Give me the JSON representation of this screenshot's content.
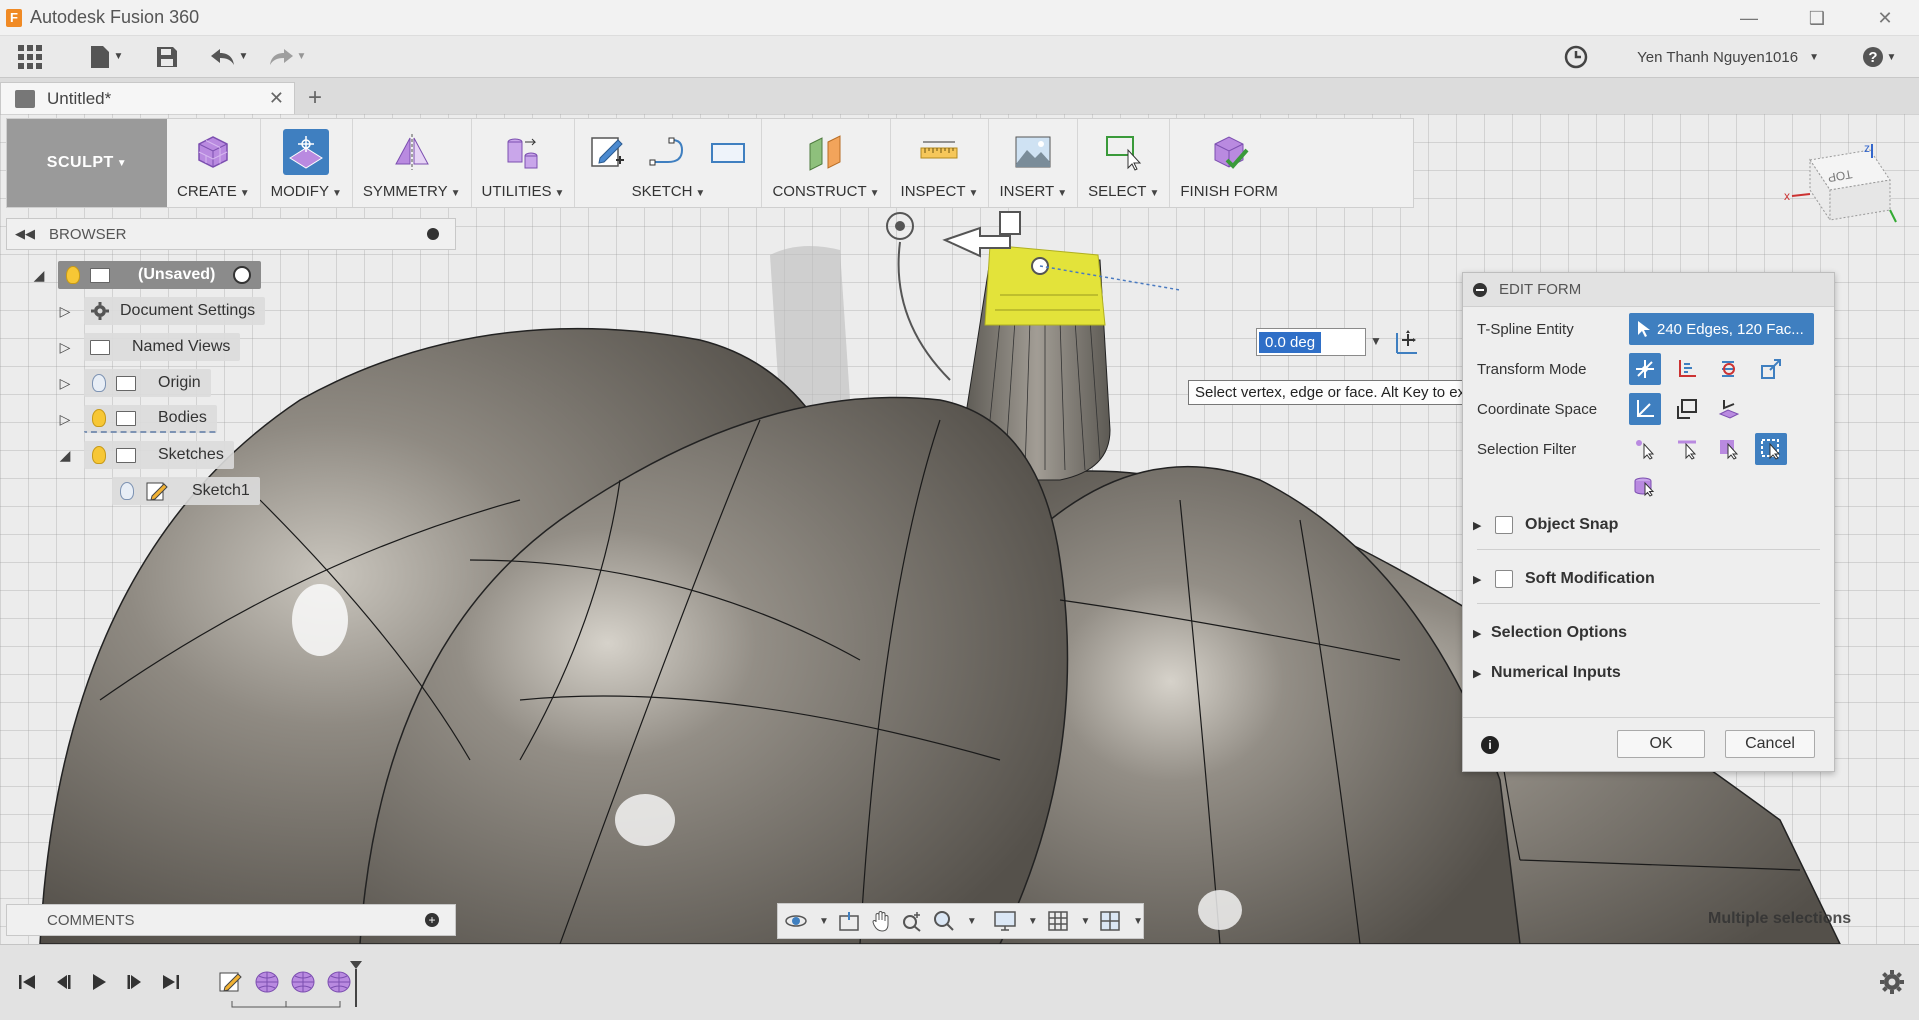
{
  "window": {
    "title": "Autodesk Fusion 360",
    "logo_letter": "F"
  },
  "appbar": {
    "user_name": "Yen Thanh Nguyen1016"
  },
  "tabs": [
    {
      "label": "Untitled*"
    }
  ],
  "ribbon": {
    "workspace": "SCULPT",
    "groups": [
      {
        "label": "CREATE"
      },
      {
        "label": "MODIFY"
      },
      {
        "label": "SYMMETRY"
      },
      {
        "label": "UTILITIES"
      },
      {
        "label": "SKETCH"
      },
      {
        "label": "CONSTRUCT"
      },
      {
        "label": "INSPECT"
      },
      {
        "label": "INSERT"
      },
      {
        "label": "SELECT"
      },
      {
        "label": "FINISH FORM"
      }
    ]
  },
  "browser": {
    "title": "BROWSER",
    "nodes": [
      {
        "label": "(Unsaved)"
      },
      {
        "label": "Document Settings"
      },
      {
        "label": "Named Views"
      },
      {
        "label": "Origin"
      },
      {
        "label": "Bodies"
      },
      {
        "label": "Sketches"
      },
      {
        "label": "Sketch1"
      }
    ]
  },
  "edit_form": {
    "title": "EDIT FORM",
    "rows": {
      "tspline_entity": "T-Spline Entity",
      "tspline_value": "240 Edges, 120 Fac...",
      "transform_mode": "Transform Mode",
      "coordinate_space": "Coordinate Space",
      "selection_filter": "Selection Filter"
    },
    "sections": {
      "object_snap": "Object Snap",
      "soft_modification": "Soft Modification",
      "selection_options": "Selection Options",
      "numerical_inputs": "Numerical Inputs"
    },
    "ok_label": "OK",
    "cancel_label": "Cancel"
  },
  "manipulator": {
    "angle_value": "0.0 deg",
    "tooltip": "Select vertex, edge or face. Alt Key to extrude"
  },
  "comments": {
    "title": "COMMENTS"
  },
  "status": {
    "selection_text": "Multiple selections"
  },
  "viewcube": {
    "face_label": "TOP",
    "axis_x": "x",
    "axis_z": "z"
  },
  "colors": {
    "accent_blue": "#3f7fc0",
    "body_gray": "#77736b",
    "highlight_yellow": "#e3e33a",
    "tspline_purple": "#9b5ec9"
  }
}
